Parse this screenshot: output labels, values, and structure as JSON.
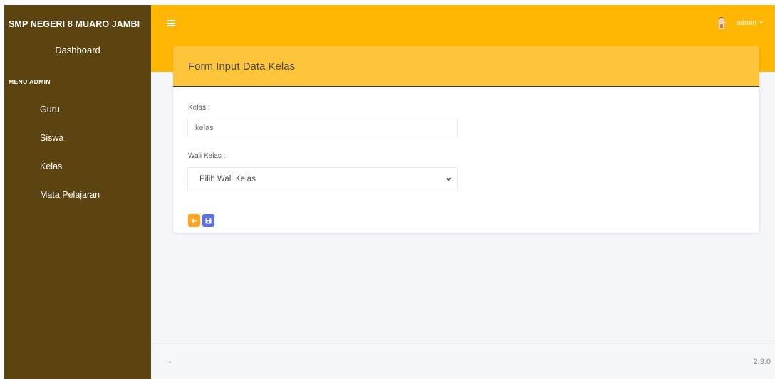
{
  "sidebar": {
    "brand": "SMP NEGERI 8 MUARO JAMBI",
    "dashboard": "Dashboard",
    "header": "MENU ADMIN",
    "items": [
      {
        "label": "Guru"
      },
      {
        "label": "Siswa"
      },
      {
        "label": "Kelas"
      },
      {
        "label": "Mata Pelajaran"
      }
    ]
  },
  "topbar": {
    "user": "admin",
    "menu_icon": "hamburger-icon",
    "avatar_icon": "user-avatar-icon"
  },
  "form": {
    "title": "Form Input Data Kelas",
    "kelas_label": "Kelas :",
    "kelas_value": "kelas",
    "wali_label": "Wali Kelas :",
    "wali_selected": "Pilih Wali Kelas",
    "back_icon": "arrow-left-icon",
    "save_icon": "save-icon"
  },
  "footer": {
    "dot": "•",
    "version": "2.3.0"
  },
  "colors": {
    "sidebar": "#5b4410",
    "topbar": "#ffb703",
    "card_header": "#ffc53a",
    "back_button": "#ffa51f",
    "save_button": "#5b6fe6"
  }
}
